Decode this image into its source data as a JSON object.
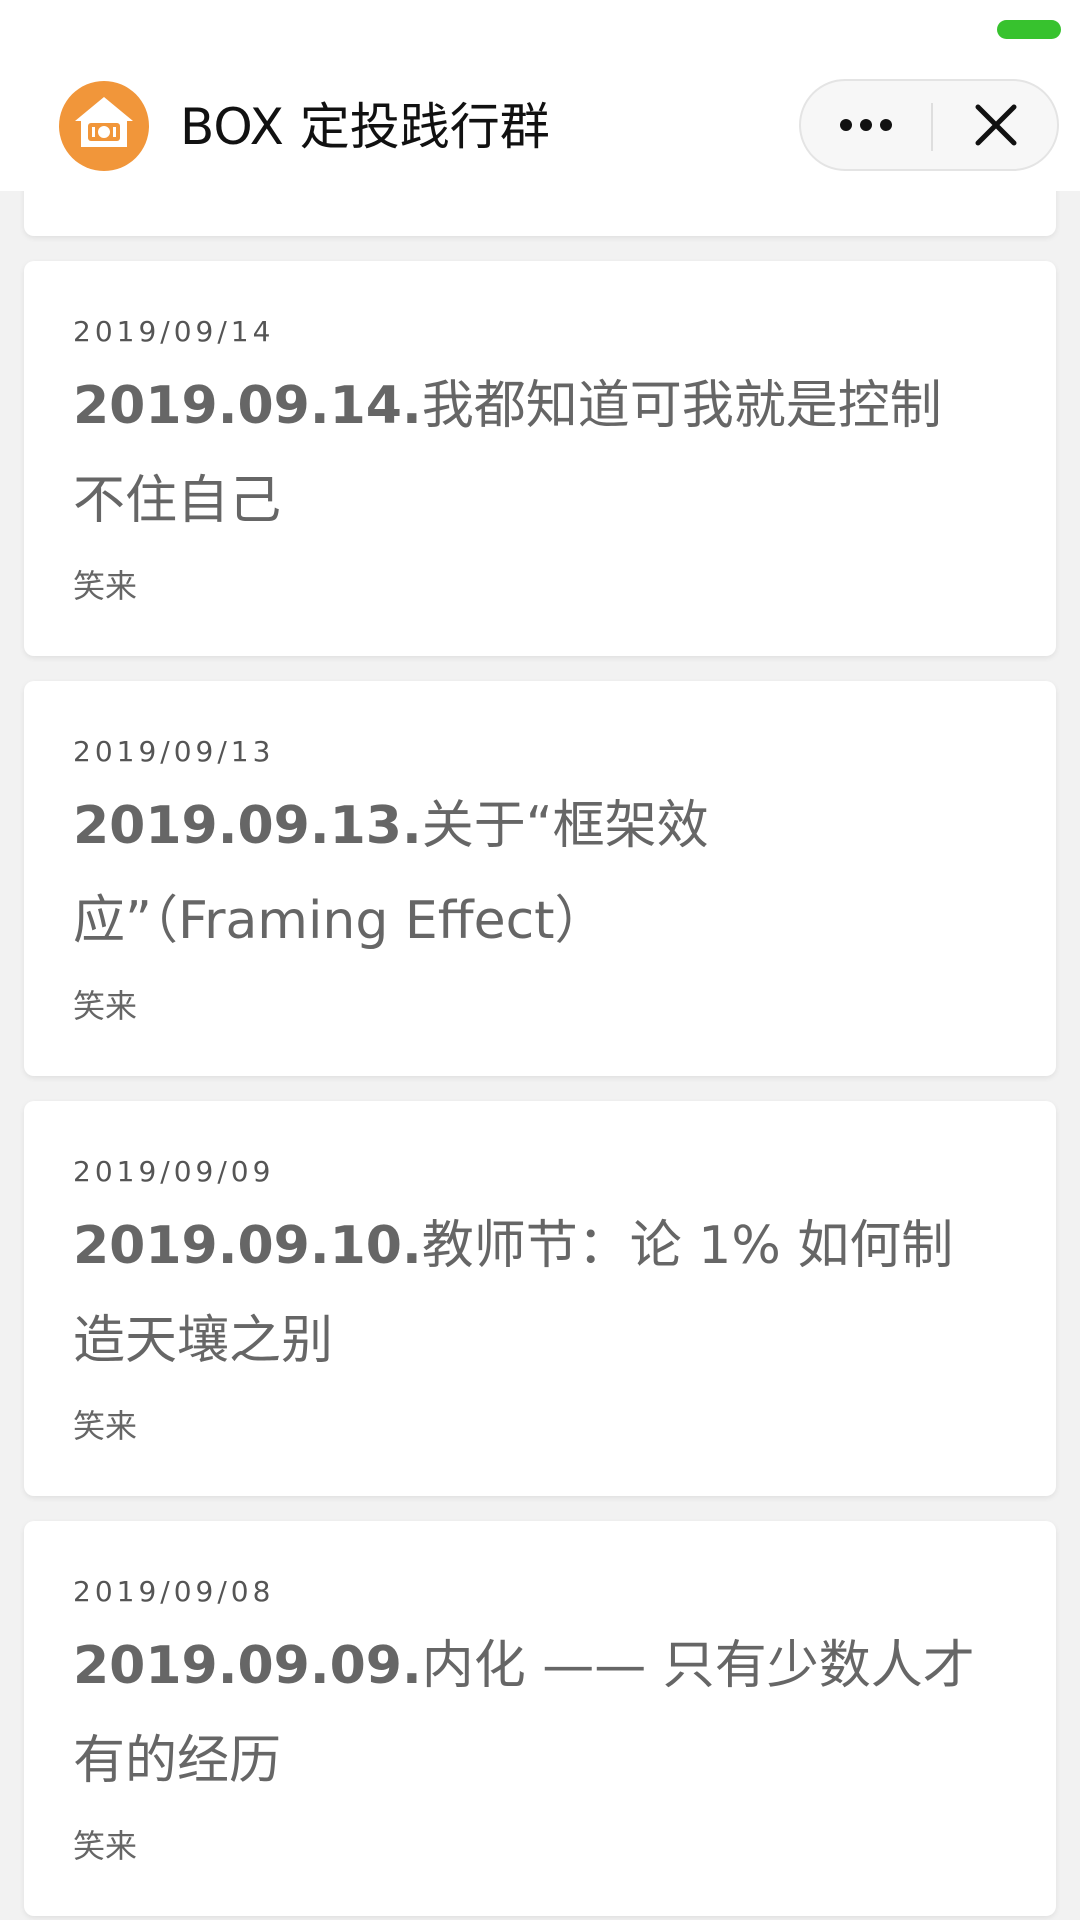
{
  "header": {
    "title": "BOX 定投践行群",
    "logo_icon": "piggy-bank-house-icon",
    "more_icon": "more-dots-icon",
    "close_icon": "close-icon"
  },
  "colors": {
    "status_pill": "#37c22e",
    "logo": "#f1963a"
  },
  "articles": [
    {
      "date": "2019/09/14",
      "title_prefix": "2019.09.14.",
      "title_text": "我都知道可我就是控制不住自己",
      "author": "笑来"
    },
    {
      "date": "2019/09/13",
      "title_prefix": "2019.09.13.",
      "title_text": "关于“框架效应”（Framing Effect）",
      "author": "笑来"
    },
    {
      "date": "2019/09/09",
      "title_prefix": "2019.09.10.",
      "title_text": "教师节：论 1% 如何制造天壤之别",
      "author": "笑来"
    },
    {
      "date": "2019/09/08",
      "title_prefix": "2019.09.09.",
      "title_text": "内化 —— 只有少数人才有的经历",
      "author": "笑来"
    }
  ]
}
